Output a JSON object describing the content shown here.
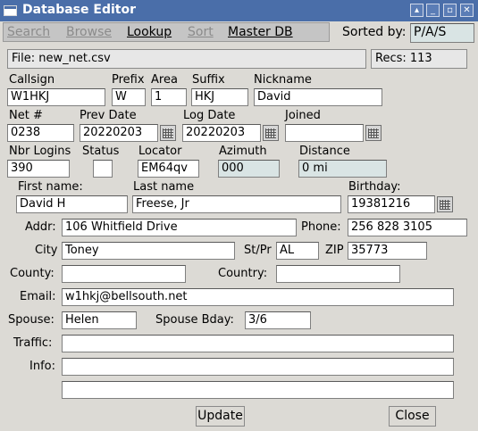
{
  "window": {
    "title": "Database Editor"
  },
  "menu": {
    "search": "Search",
    "browse": "Browse",
    "lookup": "Lookup",
    "sort": "Sort",
    "master_db": "Master DB",
    "sorted_by_label": "Sorted by:",
    "sorted_by_value": "P/A/S"
  },
  "file": {
    "label": "File: new_net.csv",
    "recs": "Recs: 113"
  },
  "labels": {
    "callsign": "Callsign",
    "prefix": "Prefix",
    "area": "Area",
    "suffix": "Suffix",
    "nickname": "Nickname",
    "net_no": "Net #",
    "prev_date": "Prev Date",
    "log_date": "Log Date",
    "joined": "Joined",
    "nbr_logins": "Nbr Logins",
    "status": "Status",
    "locator": "Locator",
    "azimuth": "Azimuth",
    "distance": "Distance",
    "first_name": "First name:",
    "last_name": "Last name",
    "birthday": "Birthday:",
    "addr": "Addr:",
    "phone": "Phone:",
    "city": "City",
    "st_pr": "St/Pr",
    "zip": "ZIP",
    "county": "County:",
    "country": "Country:",
    "email": "Email:",
    "spouse": "Spouse:",
    "spouse_bday": "Spouse Bday:",
    "traffic": "Traffic:",
    "info": "Info:"
  },
  "values": {
    "callsign": "W1HKJ",
    "prefix": "W",
    "area": "1",
    "suffix": "HKJ",
    "nickname": "David",
    "net_no": "0238",
    "prev_date": "20220203",
    "log_date": "20220203",
    "joined": "",
    "nbr_logins": "390",
    "status": "",
    "locator": "EM64qv",
    "azimuth": "000",
    "distance": "0  mi",
    "first_name": "David H",
    "last_name": "Freese, Jr",
    "birthday": "19381216",
    "addr": "106 Whitfield Drive",
    "phone": "256 828 3105",
    "city": "Toney",
    "st_pr": "AL",
    "zip": "35773",
    "county": "",
    "country": "",
    "email": "w1hkj@bellsouth.net",
    "spouse": "Helen",
    "spouse_bday": "3/6",
    "traffic": "",
    "info": "",
    "info2": ""
  },
  "buttons": {
    "update": "Update",
    "close": "Close"
  }
}
